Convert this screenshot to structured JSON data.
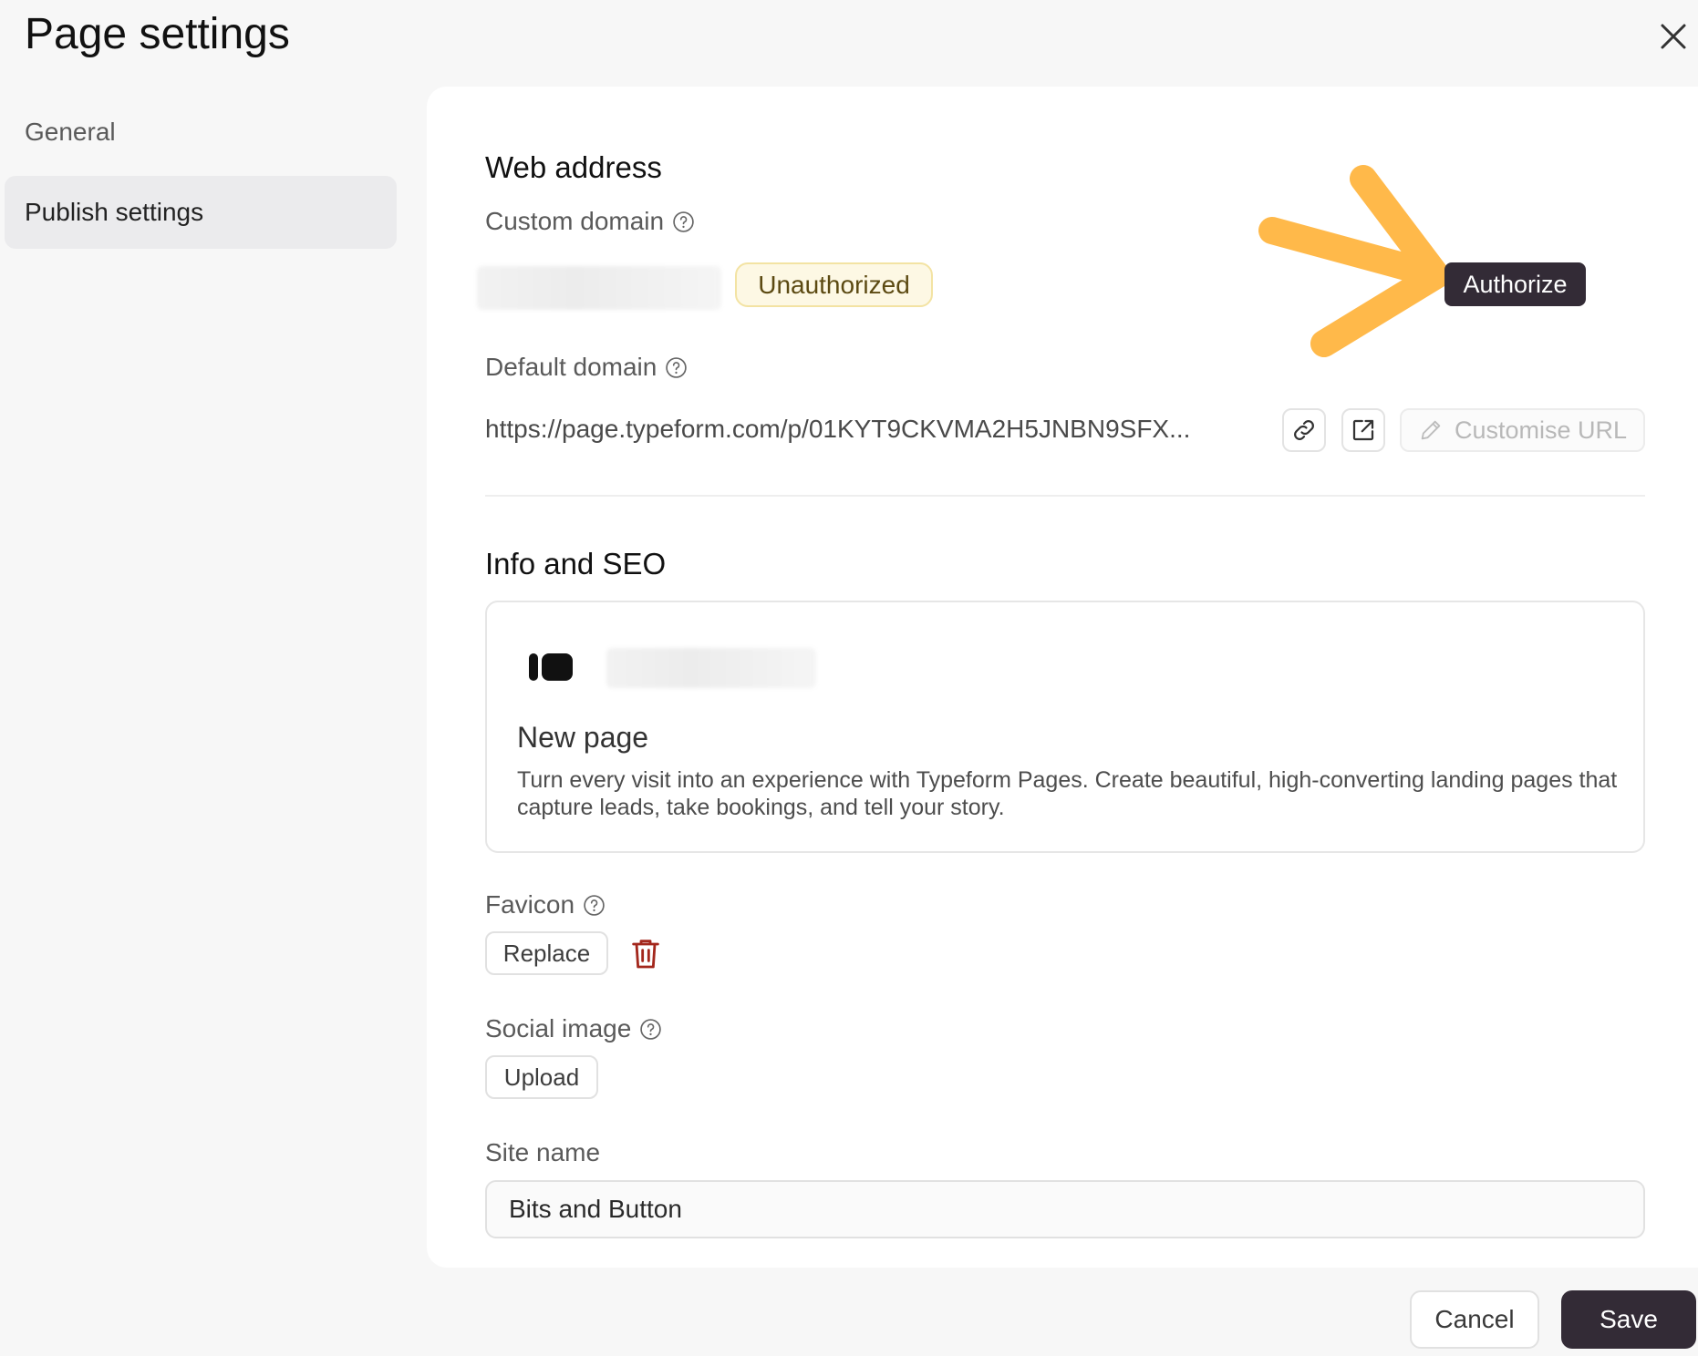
{
  "header": {
    "title": "Page settings"
  },
  "sidebar": {
    "items": [
      {
        "label": "General"
      },
      {
        "label": "Publish settings"
      }
    ]
  },
  "web_address": {
    "title": "Web address",
    "custom_domain_label": "Custom domain",
    "status_badge": "Unauthorized",
    "authorize_label": "Authorize",
    "default_domain_label": "Default domain",
    "default_url": "https://page.typeform.com/p/01KYT9CKVMA2H5JNBN9SFX...",
    "customise_label": "Customise URL"
  },
  "info_seo": {
    "title": "Info and SEO",
    "preview_title": "New page",
    "preview_description": "Turn every visit into an experience with Typeform Pages. Create beautiful, high-converting landing pages that capture leads, take bookings, and tell your story.",
    "favicon_label": "Favicon",
    "replace_label": "Replace",
    "social_image_label": "Social image",
    "upload_label": "Upload",
    "site_name_label": "Site name",
    "site_name_value": "Bits and Button"
  },
  "footer": {
    "cancel_label": "Cancel",
    "save_label": "Save"
  },
  "colors": {
    "accent_dark": "#332b36",
    "arrow": "#ffb94a",
    "badge_bg": "#fdf8e4",
    "delete_red": "#a3271c"
  }
}
